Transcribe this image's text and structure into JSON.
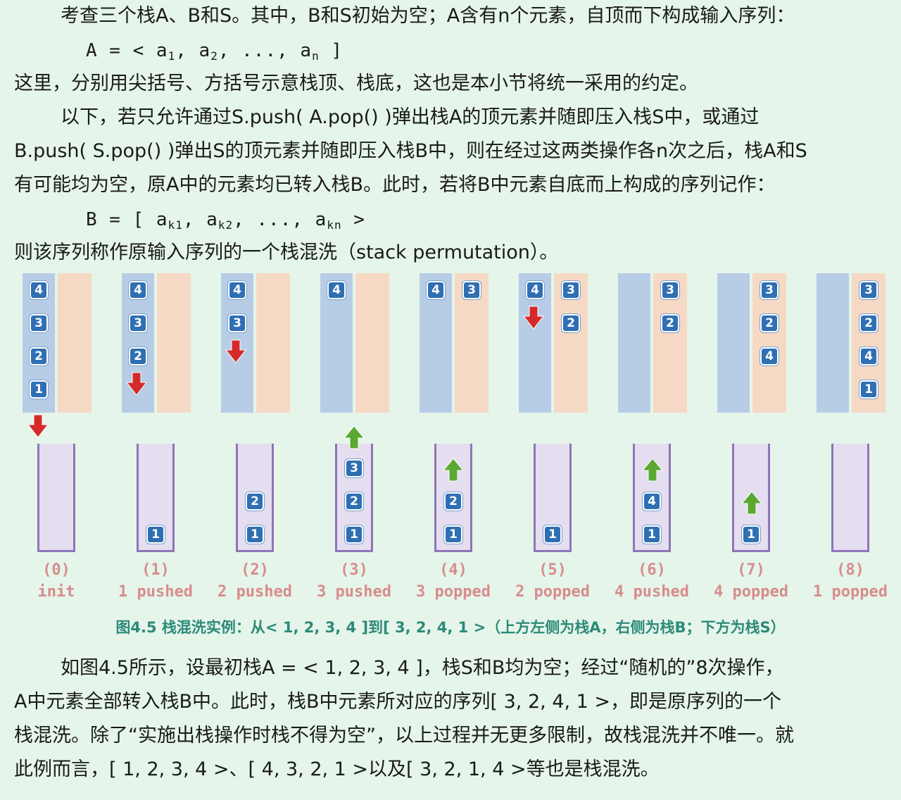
{
  "text": {
    "p1": "考查三个栈A、B和S。其中，B和S初始为空；A含有n个元素，自顶而下构成输入序列：",
    "formulaA": {
      "lhs": "A  =  < a",
      "s1": "1",
      ",a2": ", a",
      "s2": "2",
      ",dots": ",  ...,  a",
      "sn": "n",
      "end": " ]"
    },
    "p2": "这里，分别用尖括号、方括号示意栈顶、栈底，这也是本小节将统一采用的约定。",
    "p3a": "以下，若只允许通过S.push( A.pop() )弹出栈A的顶元素并随即压入栈S中，或通过",
    "p3b": "B.push( S.pop() )弹出S的顶元素并随即压入栈B中，则在经过这两类操作各n次之后，栈A和S",
    "p3c": "有可能均为空，原A中的元素均已转入栈B。此时，若将B中元素自底而上构成的序列记作：",
    "formulaB": {
      "lhs": "B  =  [ a",
      "s1": "k1",
      ",a2": ", a",
      "s2": "k2",
      ",dots": ",  ...,  a",
      "sn": "kn",
      "end": " >"
    },
    "p4": "则该序列称作原输入序列的一个栈混洗（stack permutation）。",
    "p5a": "如图4.5所示，设最初栈A = < 1, 2, 3, 4 ]，栈S和B均为空；经过“随机的”8次操作，",
    "p5b": "A中元素全部转入栈B中。此时，栈B中元素所对应的序列[ 3, 2, 4, 1 >，即是原序列的一个",
    "p5c": "栈混洗。除了“实施出栈操作时栈不得为空”，以上过程并无更多限制，故栈混洗并不唯一。就",
    "p5d": "此例而言，[ 1, 2, 3, 4 >、[ 4, 3, 2, 1 >以及[ 3, 2, 1, 4 >等也是栈混洗。"
  },
  "figure": {
    "caption": "图4.5  栈混洗实例：从< 1, 2, 3, 4 ]到[ 3, 2, 4, 1 >（上方左侧为栈A，右侧为栈B；下方为栈S）",
    "steps": [
      {
        "num": "(0)",
        "label": "init",
        "A": [
          "4",
          "3",
          "2",
          "1"
        ],
        "B": [],
        "S": []
      },
      {
        "num": "(1)",
        "label": "1 pushed",
        "A": [
          "4",
          "3",
          "2"
        ],
        "B": [],
        "S": [
          "1"
        ]
      },
      {
        "num": "(2)",
        "label": "2 pushed",
        "A": [
          "4",
          "3"
        ],
        "B": [],
        "S": [
          "2",
          "1"
        ]
      },
      {
        "num": "(3)",
        "label": "3 pushed",
        "A": [
          "4"
        ],
        "B": [],
        "S": [
          "3",
          "2",
          "1"
        ]
      },
      {
        "num": "(4)",
        "label": "3 popped",
        "A": [
          "4"
        ],
        "B": [
          "3"
        ],
        "S": [
          "2",
          "1"
        ]
      },
      {
        "num": "(5)",
        "label": "2 popped",
        "A": [
          "4"
        ],
        "B": [
          "3",
          "2"
        ],
        "S": [
          "1"
        ]
      },
      {
        "num": "(6)",
        "label": "4 pushed",
        "A": [],
        "B": [
          "3",
          "2"
        ],
        "S": [
          "4",
          "1"
        ]
      },
      {
        "num": "(7)",
        "label": "4 popped",
        "A": [],
        "B": [
          "3",
          "2",
          "4"
        ],
        "S": [
          "1"
        ]
      },
      {
        "num": "(8)",
        "label": "1 popped",
        "A": [],
        "B": [
          "3",
          "2",
          "4",
          "1"
        ],
        "S": []
      }
    ]
  },
  "colors": {
    "stackA": "#b7cde6",
    "stackB": "#f6d9c5",
    "stackS": "#e4def0",
    "chip": "#2f6fb3",
    "arrowDown": "#d42a2a",
    "arrowUp": "#5aa832",
    "caption": "#2d8a79",
    "label": "#d88c8c"
  }
}
